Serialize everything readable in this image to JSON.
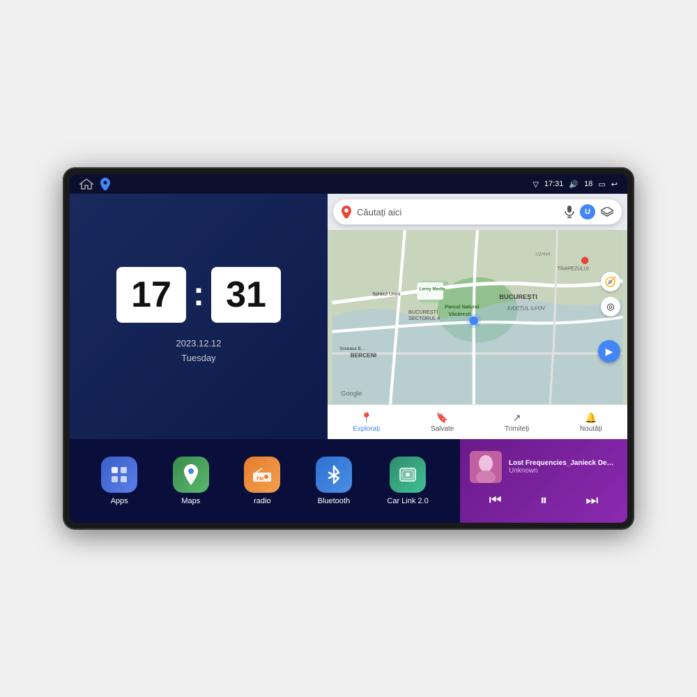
{
  "device": {
    "status_bar": {
      "signal_icon": "▽",
      "time": "17:31",
      "volume_icon": "🔊",
      "volume_level": "18",
      "battery_icon": "▭",
      "back_icon": "↩"
    },
    "clock": {
      "hour": "17",
      "minute": "31",
      "date": "2023.12.12",
      "day": "Tuesday"
    },
    "map": {
      "search_placeholder": "Căutați aici",
      "tabs": [
        {
          "label": "Explorați",
          "active": true
        },
        {
          "label": "Salvate",
          "active": false
        },
        {
          "label": "Trimiteți",
          "active": false
        },
        {
          "label": "Noutăți",
          "active": false
        }
      ],
      "labels": {
        "parcul": "Parcul Natural Văcărești",
        "leroy": "Leroy Merlin",
        "bucuresti": "BUCUREȘTI",
        "ilfov": "JUDEȚUL ILFOV",
        "berceni": "BERCENI",
        "trapezului": "TRAPEZULUI",
        "sector4": "BUCUREȘTI\nSECTORUL 4",
        "google": "Google"
      }
    },
    "apps": [
      {
        "id": "apps",
        "label": "Apps",
        "icon_class": "app-icon-apps",
        "icon_char": "⊞"
      },
      {
        "id": "maps",
        "label": "Maps",
        "icon_class": "app-icon-maps",
        "icon_char": "📍"
      },
      {
        "id": "radio",
        "label": "radio",
        "icon_class": "app-icon-radio",
        "icon_char": "📻"
      },
      {
        "id": "bluetooth",
        "label": "Bluetooth",
        "icon_class": "app-icon-bluetooth",
        "icon_char": "⬡"
      },
      {
        "id": "carlink",
        "label": "Car Link 2.0",
        "icon_class": "app-icon-carlink",
        "icon_char": "🔲"
      }
    ],
    "music": {
      "title": "Lost Frequencies_Janieck Devy-...",
      "artist": "Unknown",
      "prev_label": "⏮",
      "play_label": "⏸",
      "next_label": "⏭"
    }
  }
}
